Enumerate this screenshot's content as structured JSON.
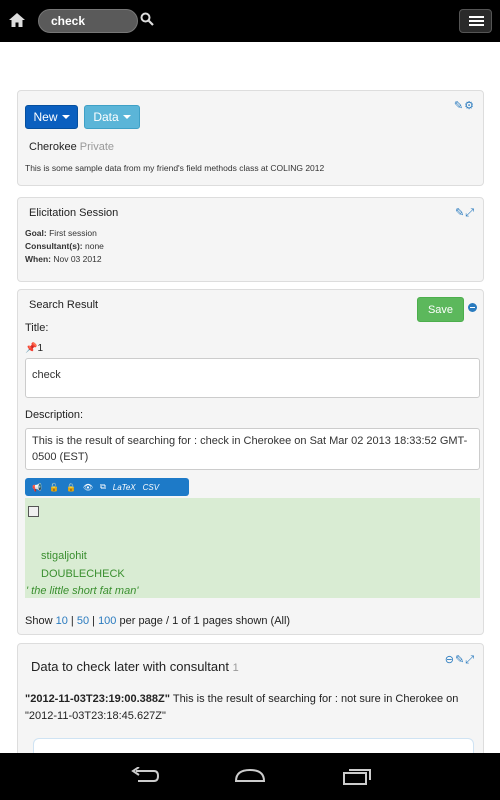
{
  "topbar": {
    "search_value": "check"
  },
  "corpus_panel": {
    "new_label": "New",
    "data_label": "Data",
    "corpus_name": "Cherokee",
    "privacy": "Private",
    "description": "This is some sample data from my friend's field methods class at COLING 2012"
  },
  "session_panel": {
    "title": "Elicitation Session",
    "goal_label": "Goal:",
    "goal_value": "First session",
    "consultants_label": "Consultant(s):",
    "consultants_value": "none",
    "when_label": "When:",
    "when_value": "Nov 03 2012"
  },
  "search_panel": {
    "title": "Search Result",
    "save_label": "Save",
    "title_label": "Title:",
    "pin_count": "1",
    "title_value": "check",
    "description_label": "Description:",
    "description_value": "This is the result of searching for : check in Cherokee on Sat Mar 02 2013 18:33:52 GMT-0500 (EST)",
    "toolbar_latex": "LaTeX",
    "toolbar_csv": "CSV",
    "datum": {
      "line1": "stigaljohit",
      "line2": "DOUBLECHECK",
      "translation": "' the little short fat man'"
    },
    "pagination": {
      "show": "Show",
      "opt1": "10",
      "sep1": "|",
      "opt2": "50",
      "sep2": "|",
      "opt3": "100",
      "suffix": "per page / 1 of 1 pages shown (All)"
    }
  },
  "later_panel": {
    "title": "Data to check later with consultant",
    "count": "1",
    "timestamp": "\"2012-11-03T23:19:00.388Z\"",
    "text": "This is the result of searching for : not sure in Cherokee on \"2012-11-03T23:18:45.627Z\""
  },
  "colors": {
    "primary": "#0a5fbf",
    "info": "#5bb5d8",
    "success": "#5cb85c",
    "link": "#2a7bbf",
    "datum_bg": "#d9ecd3",
    "datum_text": "#3a8f2f"
  },
  "icons": [
    "home-icon",
    "search-icon",
    "menu-icon",
    "edit-icon",
    "gears-icon",
    "expand-icon",
    "pin-icon",
    "minus-circle-icon",
    "back-icon",
    "home-nav-icon",
    "recent-apps-icon"
  ]
}
